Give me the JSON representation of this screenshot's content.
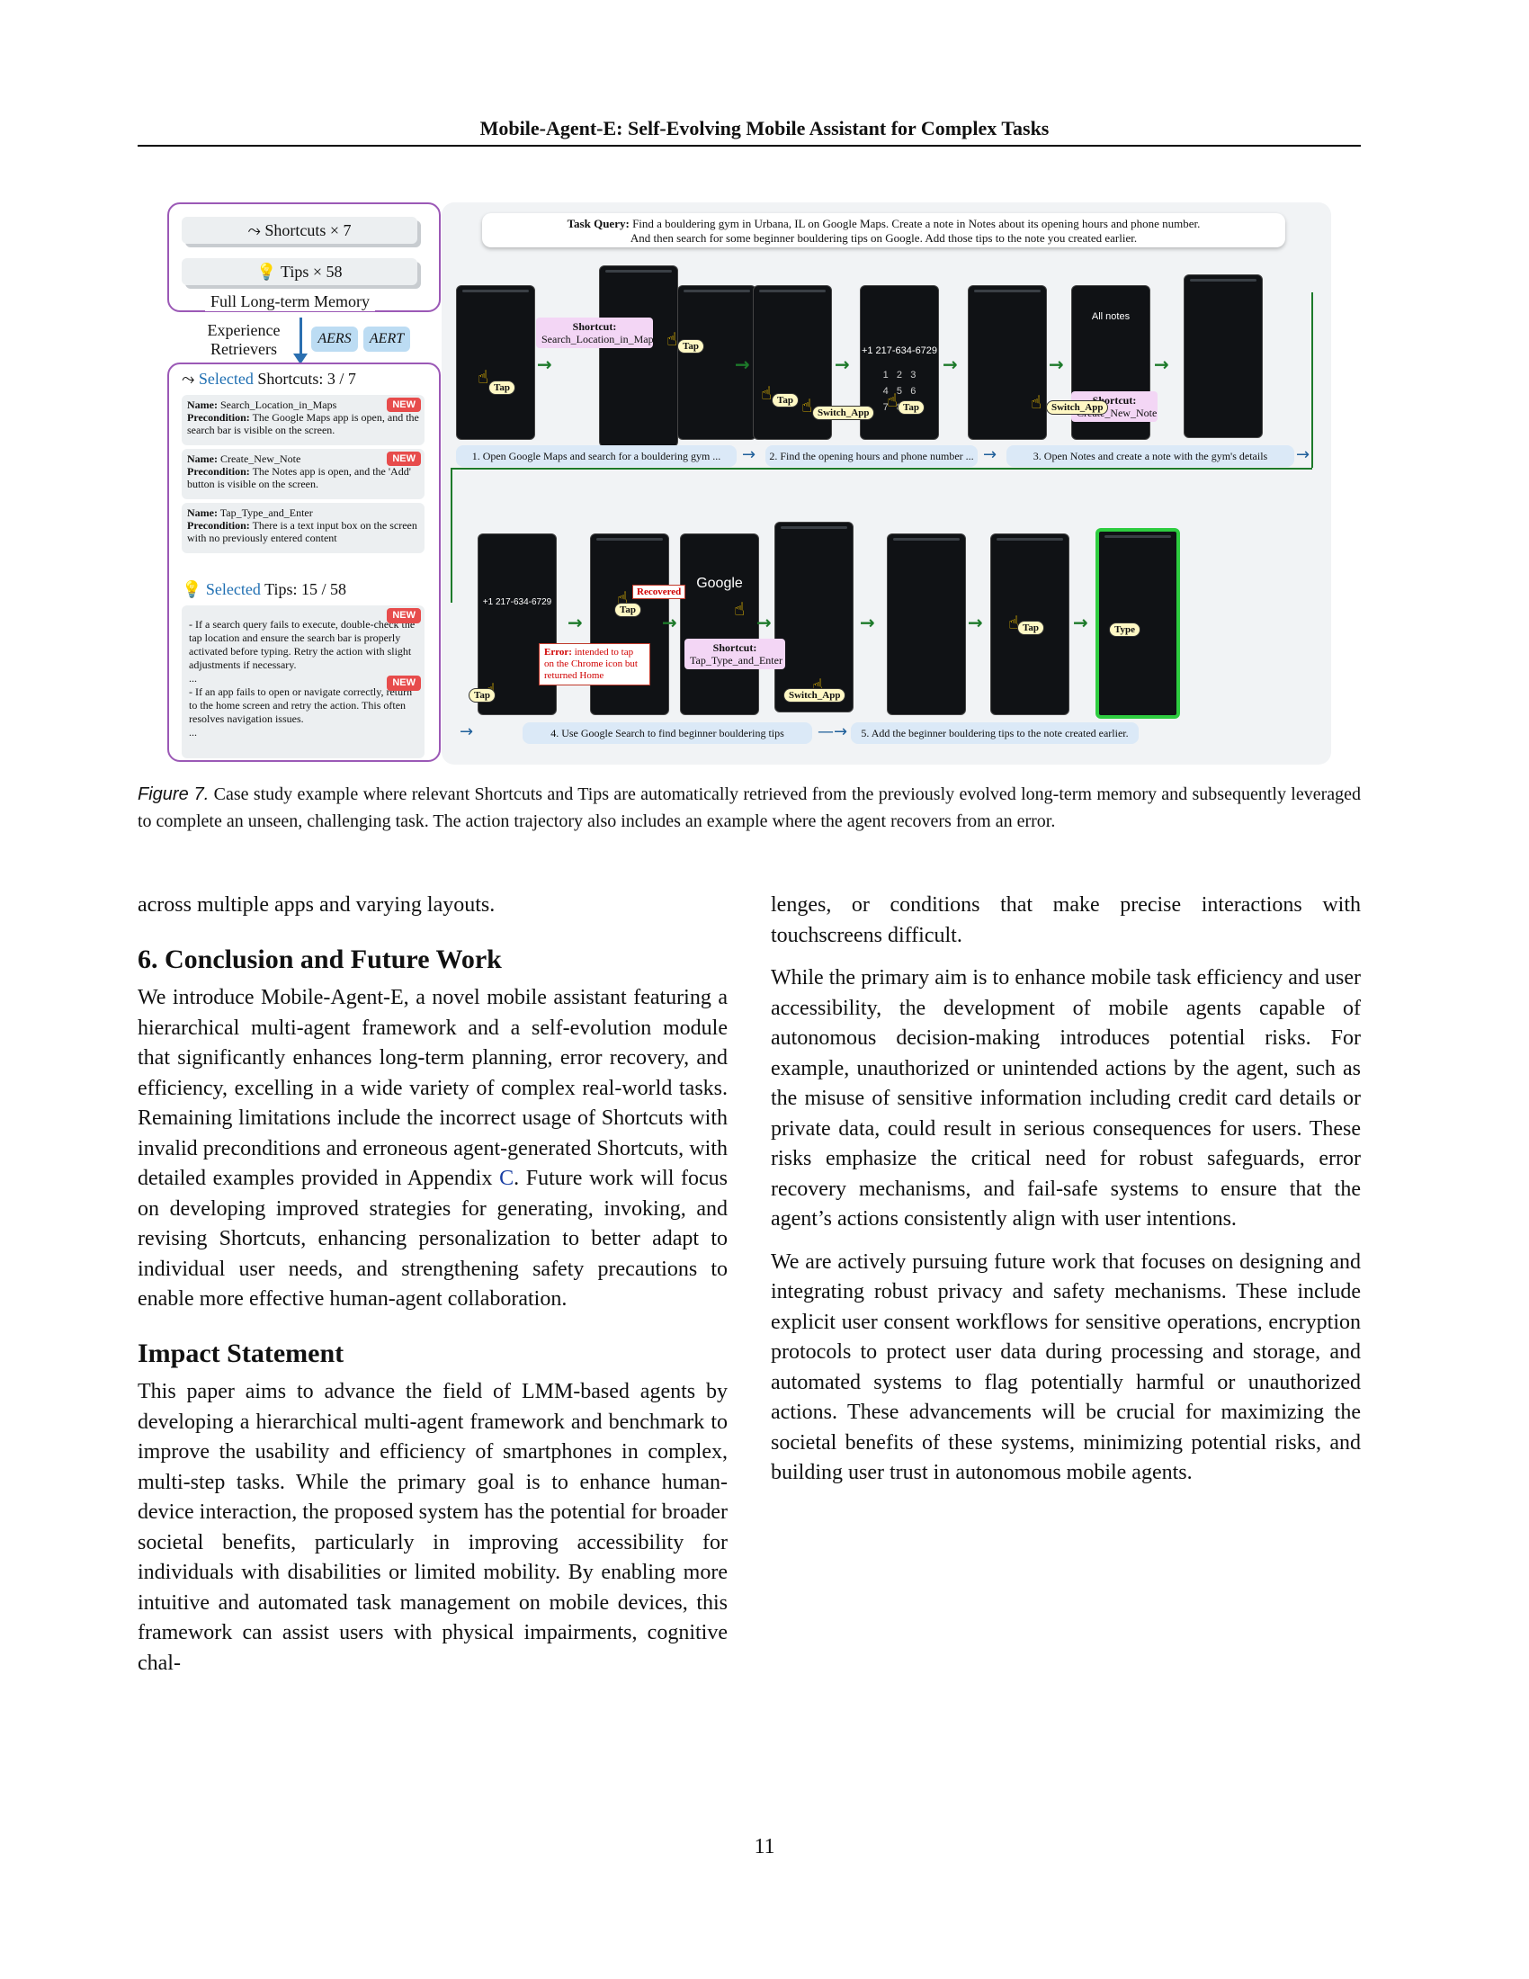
{
  "header": {
    "title": "Mobile-Agent-E: Self-Evolving Mobile Assistant for Complex Tasks"
  },
  "figure": {
    "memory": {
      "shortcuts_label": "Shortcuts × 7",
      "tips_label": "Tips × 58",
      "title": "Full Long-term Memory"
    },
    "retrievers": {
      "label_line1": "Experience",
      "label_line2": "Retrievers",
      "a_ers": "AERS",
      "a_ert": "AERT"
    },
    "selected": {
      "shortcuts_prefix": "Selected",
      "shortcuts_rest": "Shortcuts: 3 / 7",
      "tips_prefix": "Selected",
      "tips_rest": "Tips: 15 / 58",
      "new_badge": "NEW",
      "cards": [
        {
          "name_label": "Name:",
          "name": "Search_Location_in_Maps",
          "pre_label": "Precondition:",
          "pre": "The Google Maps app is open, and the search bar is visible on the screen."
        },
        {
          "name_label": "Name:",
          "name": "Create_New_Note",
          "pre_label": "Precondition:",
          "pre": "The Notes app is open, and the 'Add' button is visible on the screen."
        },
        {
          "name_label": "Name:",
          "name": "Tap_Type_and_Enter",
          "pre_label": "Precondition:",
          "pre": "There is a text input box on the screen with no previously entered content"
        }
      ],
      "tip1": "- If a search query fails to execute, double-check the tap location and ensure the search bar is properly activated before typing. Retry the action with slight adjustments if necessary.",
      "ellipsis": "...",
      "tip2": "- If an app fails to open or navigate correctly, return to the home screen and retry the action. This often resolves navigation issues."
    },
    "query": {
      "label": "Task Query:",
      "line1": "Find a bouldering gym in Urbana, IL on Google Maps. Create a note in Notes about its opening hours and phone number.",
      "line2": "And then search for some beginner bouldering tips on Google. Add those tips to the note you created earlier."
    },
    "steps": [
      "1. Open Google Maps and search for a bouldering gym ...",
      "2. Find the opening hours and phone number ...",
      "3. Open Notes and create a note with the gym's details",
      "4. Use Google Search to find beginner bouldering tips",
      "5. Add the beginner bouldering tips to the note created earlier."
    ],
    "shortcut_labels": {
      "prefix": "Shortcut:",
      "s1": "Search_Location_in_Maps",
      "s2": "Create_New_Note",
      "s3": "Tap_Type_and_Enter"
    },
    "action_tags": {
      "tap": "Tap",
      "switch_app": "Switch_App",
      "type": "Type"
    },
    "phone_text": {
      "phone_number": "+1 217-634-6729",
      "all_notes": "All notes",
      "google": "Google"
    },
    "error": {
      "label": "Error:",
      "text": "intended to tap on the Chrome icon but returned Home"
    },
    "recovered": "Recovered"
  },
  "caption": {
    "label": "Figure 7.",
    "text": "Case study example where relevant Shortcuts and Tips are automatically retrieved from the previously evolved long-term memory and subsequently leveraged to complete an unseen, challenging task. The action trajectory also includes an example where the agent recovers from an error."
  },
  "left_column": {
    "continued": "across multiple apps and varying layouts.",
    "section6_title": "6. Conclusion and Future Work",
    "section6_text_a": "We introduce Mobile-Agent-E, a novel mobile assistant featuring a hierarchical multi-agent framework and a self-evolution module that significantly enhances long-term planning, error recovery, and efficiency, excelling in a wide variety of complex real-world tasks. Remaining limitations include the incorrect usage of Shortcuts with invalid preconditions and erroneous agent-generated Shortcuts, with detailed examples provided in Appendix",
    "appendix_ref": "C",
    "section6_text_b": ". Future work will focus on developing improved strategies for generating, invoking, and revising Shortcuts, enhancing personalization to better adapt to individual user needs, and strengthening safety precautions to enable more effective human-agent collaboration.",
    "impact_title": "Impact Statement",
    "impact_text": "This paper aims to advance the field of LMM-based agents by developing a hierarchical multi-agent framework and benchmark to improve the usability and efficiency of smartphones in complex, multi-step tasks. While the primary goal is to enhance human-device interaction, the proposed system has the potential for broader societal benefits, particularly in improving accessibility for individuals with disabilities or limited mobility. By enabling more intuitive and automated task management on mobile devices, this framework can assist users with physical impairments, cognitive chal-"
  },
  "right_column": {
    "continued": "lenges, or conditions that make precise interactions with touchscreens difficult.",
    "para1": "While the primary aim is to enhance mobile task efficiency and user accessibility, the development of mobile agents capable of autonomous decision-making introduces potential risks. For example, unauthorized or unintended actions by the agent, such as the misuse of sensitive information including credit card details or private data, could result in serious consequences for users. These risks emphasize the critical need for robust safeguards, error recovery mechanisms, and fail-safe systems to ensure that the agent’s actions consistently align with user intentions.",
    "para2": "We are actively pursuing future work that focuses on designing and integrating robust privacy and safety mechanisms. These include explicit user consent workflows for sensitive operations, encryption protocols to protect user data during processing and storage, and automated systems to flag potentially harmful or unauthorized actions. These advancements will be crucial for maximizing the societal benefits of these systems, minimizing potential risks, and building user trust in autonomous mobile agents."
  },
  "page_number": "11"
}
